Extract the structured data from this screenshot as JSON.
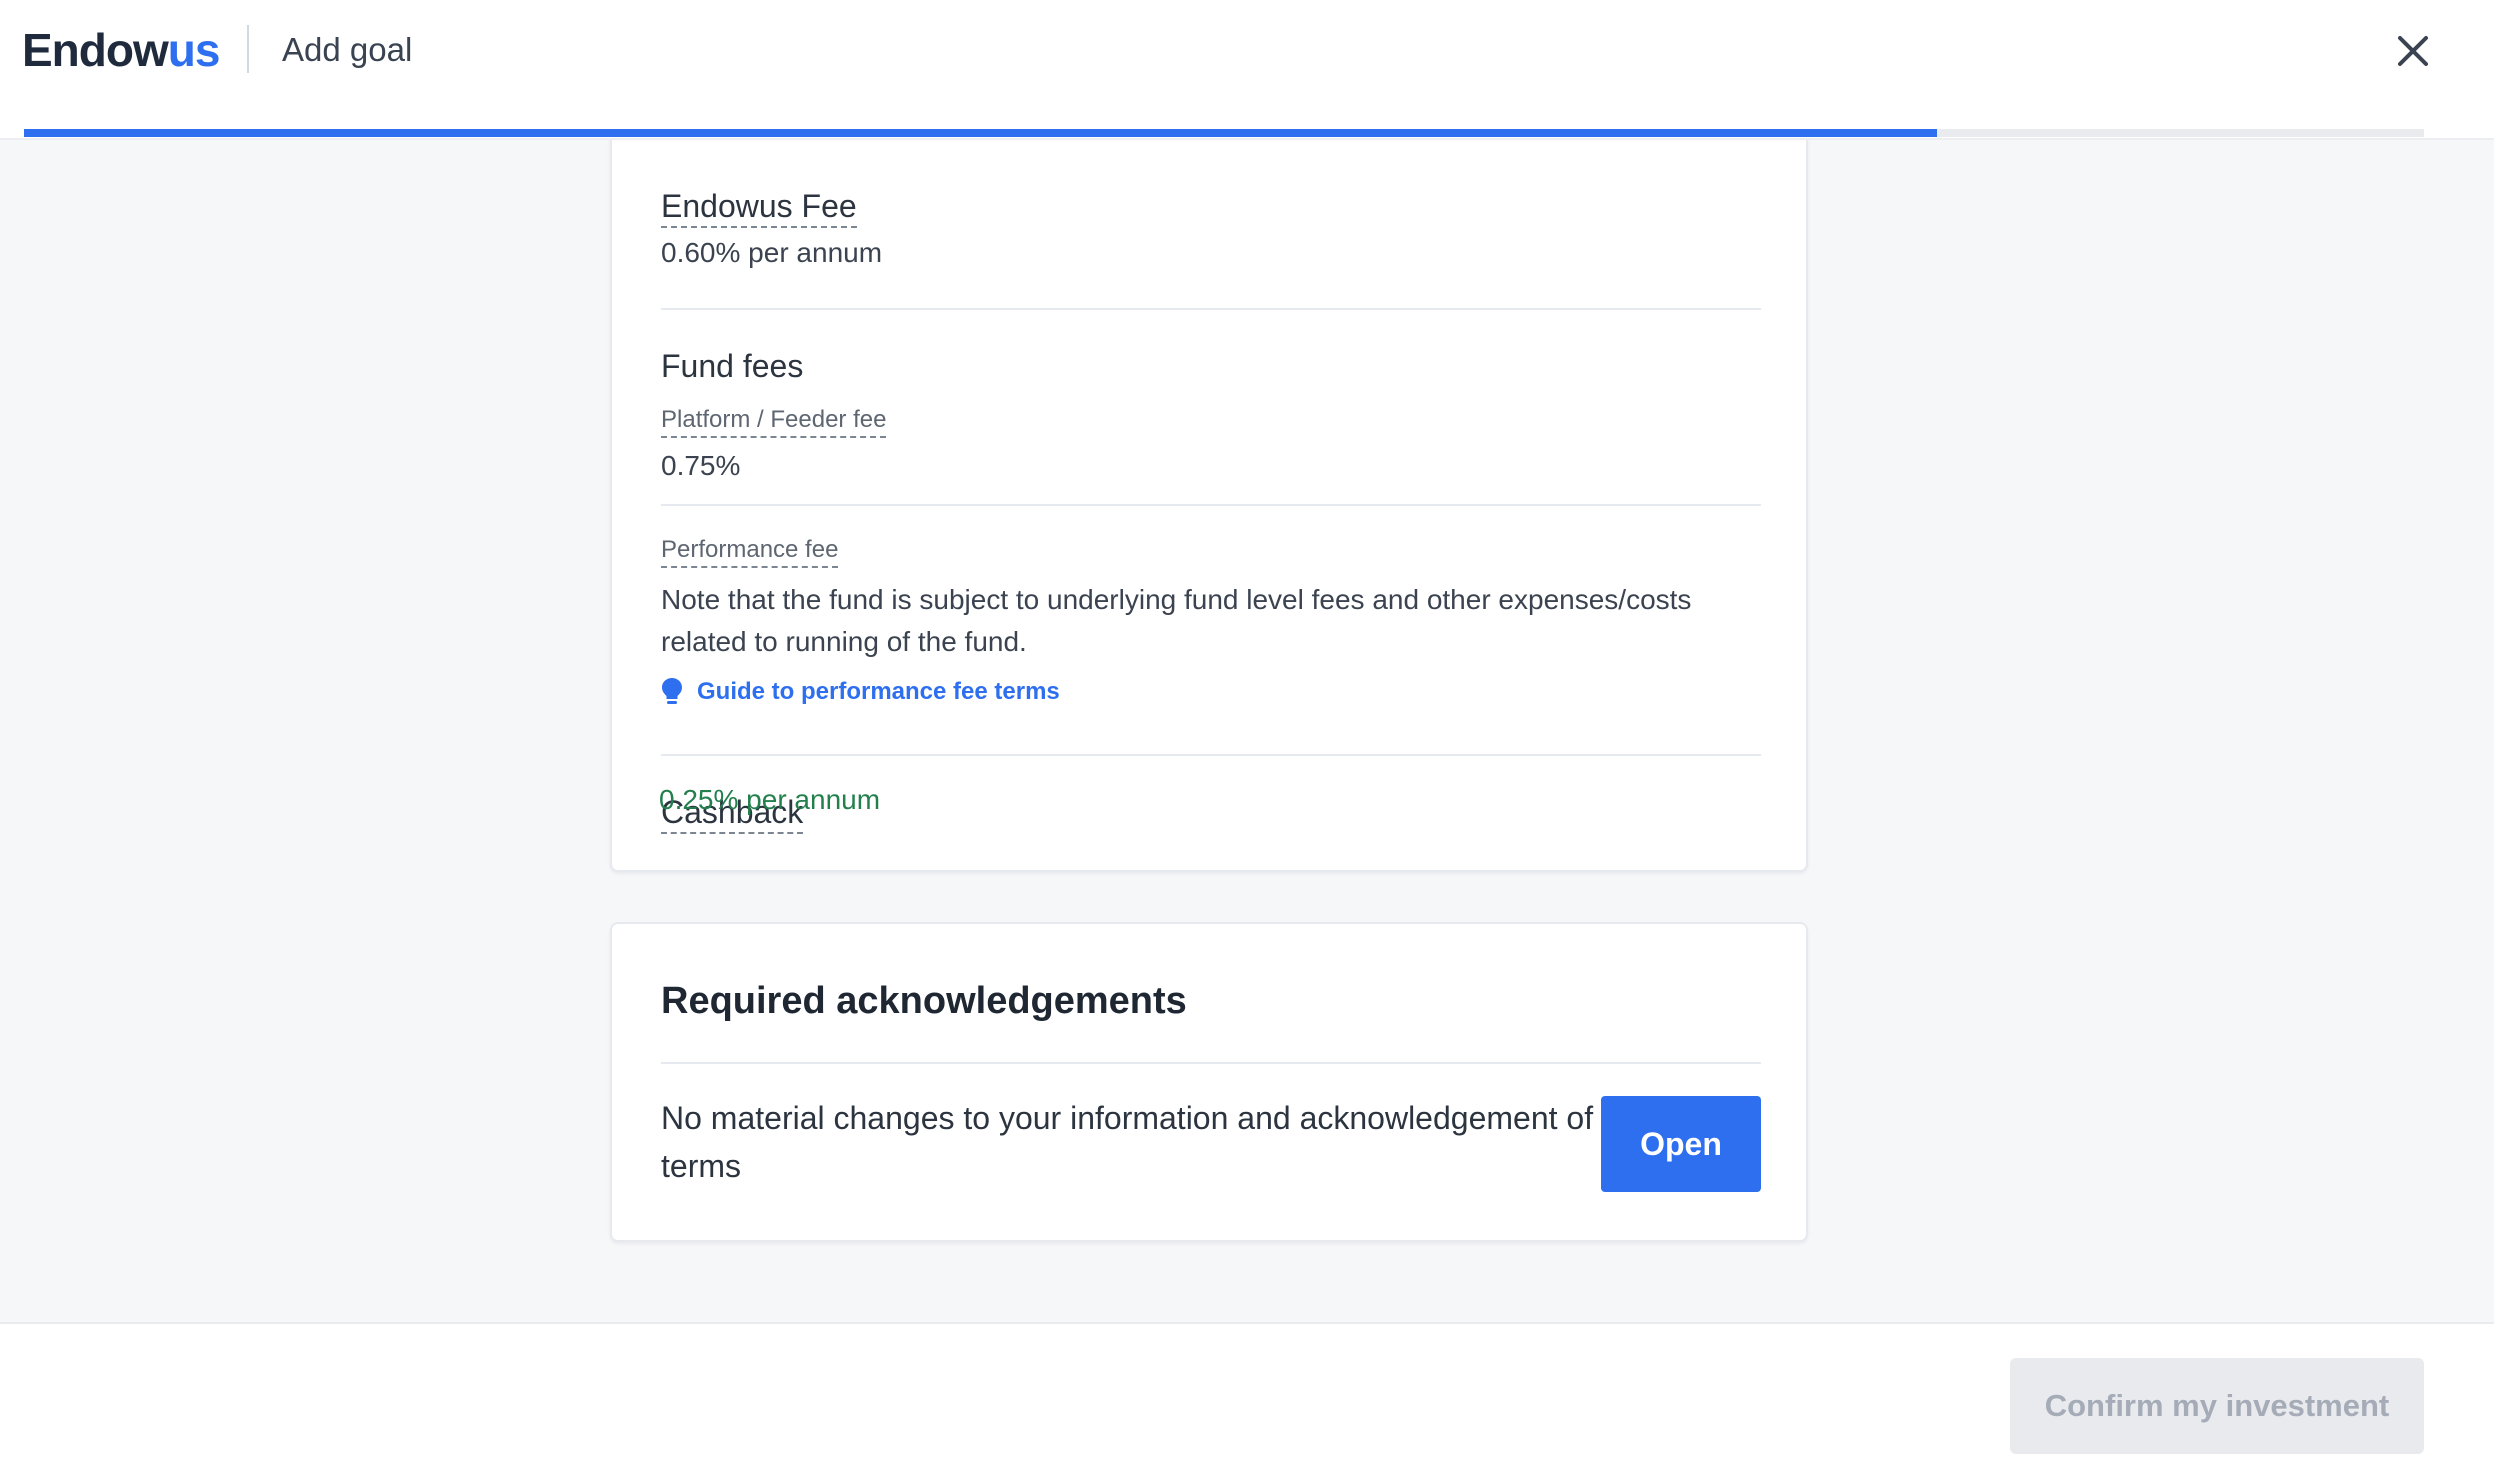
{
  "header": {
    "logo_part1": "Endow",
    "logo_part2": "us",
    "title": "Add goal",
    "progress_fraction": 0.797
  },
  "fees": {
    "endowus_fee_label": "Endowus Fee",
    "endowus_fee_value": "0.60% per annum",
    "fund_fees_title": "Fund fees",
    "platform_fee_label": "Platform / Feeder fee",
    "platform_fee_value": "0.75%",
    "performance_fee_label": "Performance fee",
    "performance_fee_note": "Note that the fund is subject to underlying fund level fees and other expenses/costs related to running of the fund.",
    "guide_link": "Guide to performance fee terms",
    "cashback_label": "Cashback",
    "cashback_value": "0.25% per annum"
  },
  "acknowledgements": {
    "title": "Required acknowledgements",
    "item_text": "No material changes to your information and acknowledgement of terms",
    "open_label": "Open"
  },
  "footer": {
    "confirm_label": "Confirm my investment"
  },
  "colors": {
    "accent": "#2e6ff0",
    "positive": "#23804d",
    "disabled_bg": "#e8eaee",
    "disabled_text": "#a5acb7"
  },
  "icons": [
    "close-icon",
    "lightbulb-icon"
  ]
}
